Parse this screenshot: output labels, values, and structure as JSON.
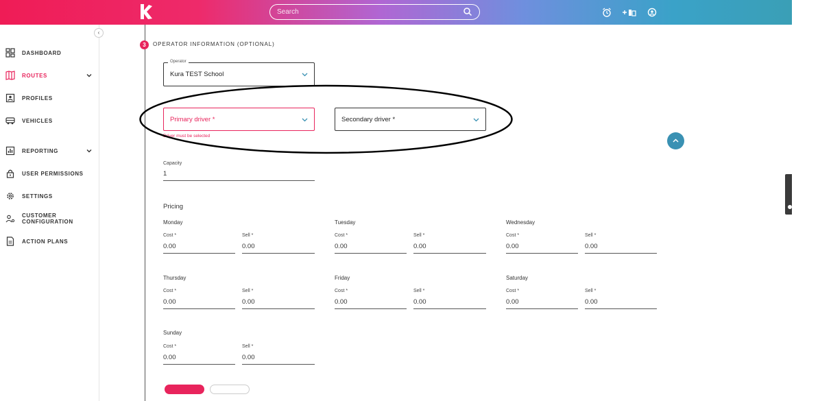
{
  "header": {
    "search_placeholder": "Search",
    "icons": [
      "logo-k-icon",
      "search-icon",
      "alarm-clock-icon",
      "add-school-icon",
      "account-icon"
    ],
    "gradient": [
      "#ef1c56",
      "#b066d3",
      "#3a9fb6"
    ]
  },
  "sidebar": {
    "collapse_symbol": "‹",
    "items": [
      {
        "label": "DASHBOARD",
        "icon": "dashboard-icon",
        "active": false
      },
      {
        "label": "ROUTES",
        "icon": "routes-icon",
        "active": true,
        "expandable": true
      },
      {
        "label": "PROFILES",
        "icon": "profiles-icon",
        "active": false
      },
      {
        "label": "VEHICLES",
        "icon": "vehicles-icon",
        "active": false
      },
      {
        "label": "REPORTING",
        "icon": "reporting-icon",
        "active": false,
        "expandable": true
      },
      {
        "label": "USER PERMISSIONS",
        "icon": "lock-icon",
        "active": false
      },
      {
        "label": "SETTINGS",
        "icon": "gear-icon",
        "active": false
      },
      {
        "label": "CUSTOMER",
        "label2": "CONFIGURATION",
        "icon": "customer-config-icon",
        "active": false
      },
      {
        "label": "ACTION PLANS",
        "icon": "document-icon",
        "active": false
      }
    ]
  },
  "section": {
    "step": "3",
    "title": "OPERATOR INFORMATION (OPTIONAL)"
  },
  "operator": {
    "legend": "Operator",
    "value": "Kura TEST School"
  },
  "drivers": {
    "primary": "Primary driver *",
    "secondary": "Secondary driver *",
    "error": "Driver must be selected"
  },
  "capacity": {
    "label": "Capacity",
    "value": "1"
  },
  "pricing": {
    "title": "Pricing",
    "cost_label": "Cost *",
    "sell_label": "Sell *",
    "days": [
      {
        "day": "Monday",
        "cost": "0.00",
        "sell": "0.00"
      },
      {
        "day": "Tuesday",
        "cost": "0.00",
        "sell": "0.00"
      },
      {
        "day": "Wednesday",
        "cost": "0.00",
        "sell": "0.00"
      },
      {
        "day": "Thursday",
        "cost": "0.00",
        "sell": "0.00"
      },
      {
        "day": "Friday",
        "cost": "0.00",
        "sell": "0.00"
      },
      {
        "day": "Saturday",
        "cost": "0.00",
        "sell": "0.00"
      },
      {
        "day": "Sunday",
        "cost": "0.00",
        "sell": "0.00"
      }
    ]
  },
  "colors": {
    "accent": "#e8245c",
    "fab": "#3a91b3",
    "annotation_ellipse": "#000000"
  }
}
